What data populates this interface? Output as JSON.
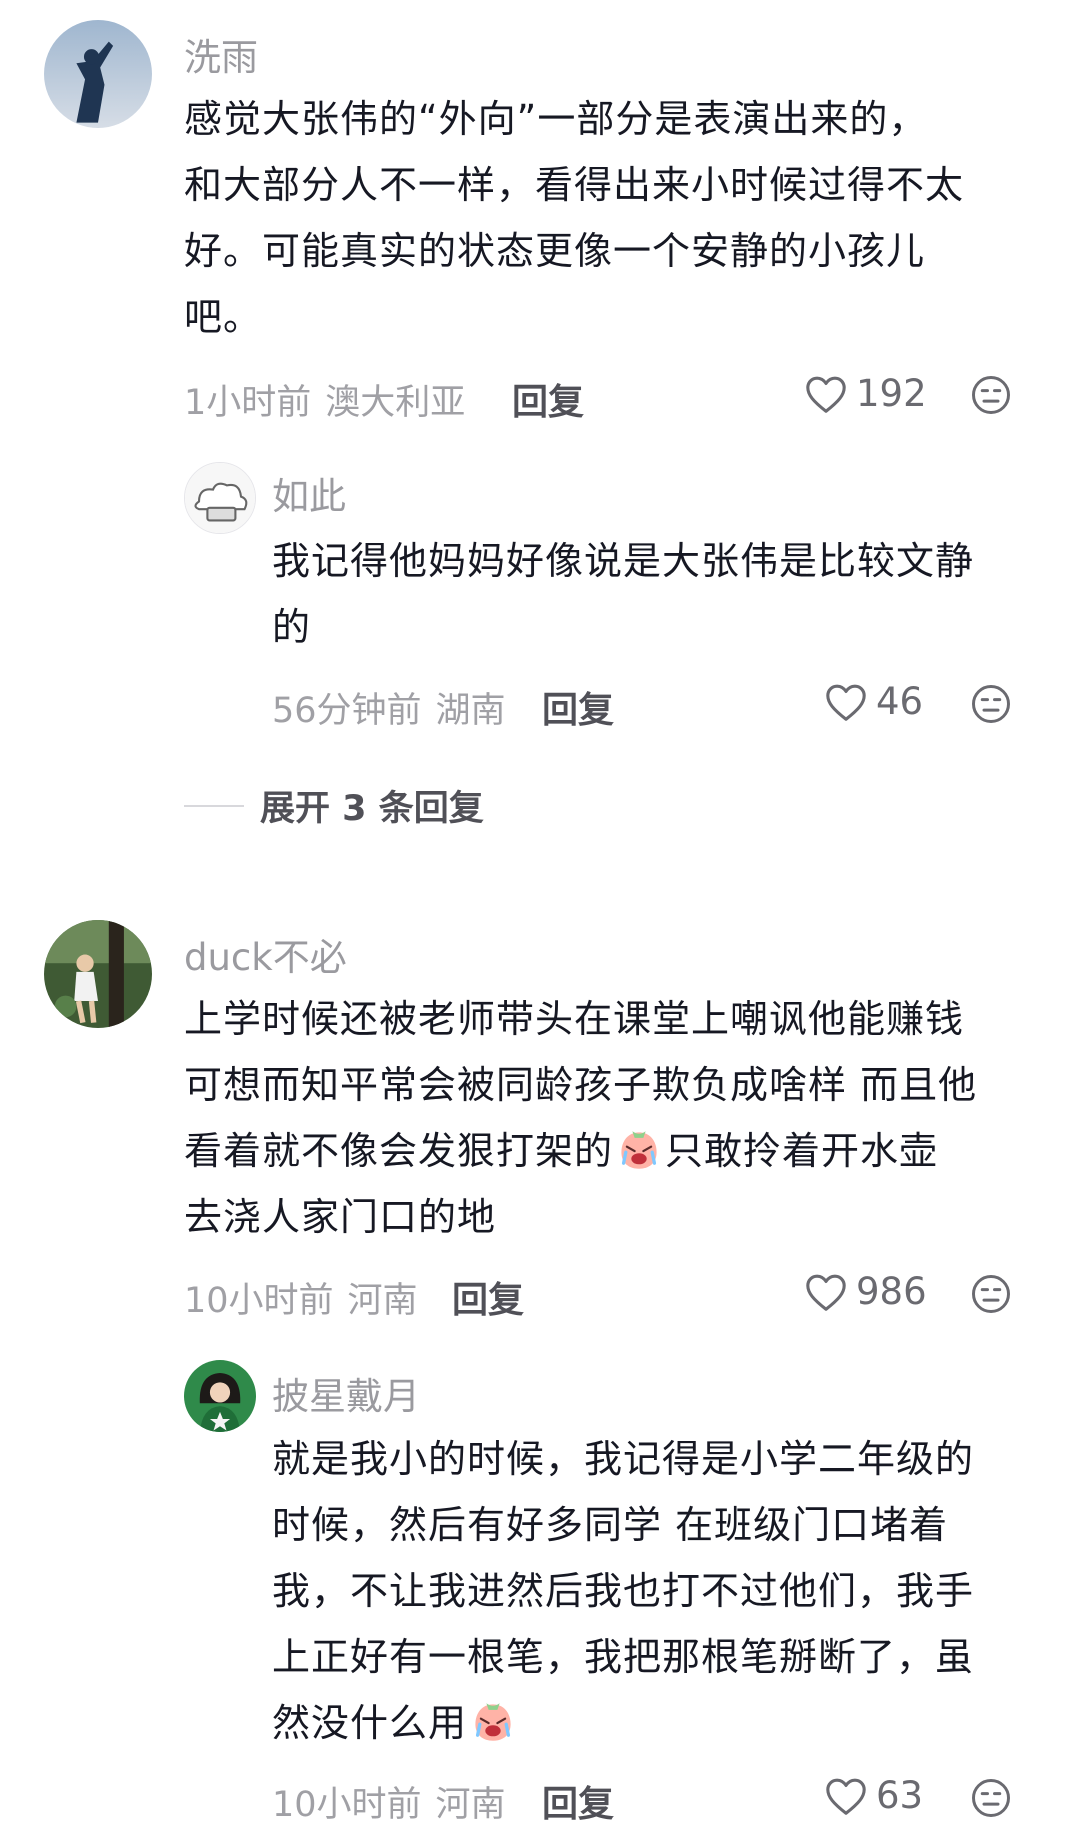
{
  "comments": [
    {
      "author": "洗雨",
      "lines": [
        "感觉大张伟的“外向”一部分是表演出来的，",
        "和大部分人不一样，看得出来小时候过得不太",
        "好。可能真实的状态更像一个安静的小孩儿",
        "吧。"
      ],
      "time": "1小时前",
      "location": "澳大利亚",
      "reply_label": "回复",
      "likes": "192",
      "replies": [
        {
          "author": "如此",
          "lines": [
            "我记得他妈妈好像说是大张伟是比较文静",
            "的"
          ],
          "time": "56分钟前",
          "location": "湖南",
          "reply_label": "回复",
          "likes": "46"
        }
      ],
      "expand_label": "展开 3 条回复"
    },
    {
      "author": "duck不必",
      "lines": [
        "上学时候还被老师带头在课堂上嘲讽他能赚钱",
        "可想而知平常会被同龄孩子欺负成啥样 而且他",
        "看着就不像会发狠打架的",
        "只敢拎着开水壶",
        "去浇人家门口的地"
      ],
      "time": "10小时前",
      "location": "河南",
      "reply_label": "回复",
      "likes": "986",
      "replies": [
        {
          "author": "披星戴月",
          "lines": [
            "就是我小的时候，我记得是小学二年级的",
            "时候，然后有好多同学 在班级门口堵着",
            "我，不让我进然后我也打不过他们，我手",
            "上正好有一根笔，我把那根笔掰断了，虽",
            "然没什么用"
          ],
          "time": "10小时前",
          "location": "河南",
          "reply_label": "回复",
          "likes": "63"
        }
      ]
    }
  ],
  "icons": {
    "like": "heart-outline-icon",
    "dislike": "neutral-face-icon",
    "emoji_1": "crying-face-emoji",
    "emoji_2": "crying-face-emoji"
  },
  "colors": {
    "text": "#161823",
    "muted": "#a0a0a5",
    "accent": "#505057"
  }
}
